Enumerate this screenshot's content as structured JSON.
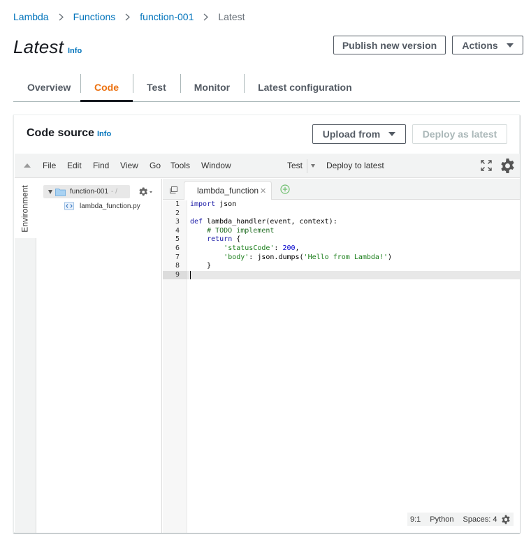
{
  "breadcrumb": {
    "items": [
      "Lambda",
      "Functions",
      "function-001"
    ],
    "current": "Latest"
  },
  "header": {
    "title": "Latest",
    "info": "Info",
    "publish_label": "Publish new version",
    "actions_label": "Actions"
  },
  "tabs": [
    "Overview",
    "Code",
    "Test",
    "Monitor",
    "Latest configuration"
  ],
  "active_tab": "Code",
  "code_source": {
    "title": "Code source",
    "info": "Info",
    "upload_label": "Upload from",
    "deploy_label": "Deploy as latest"
  },
  "ide": {
    "menu": [
      "File",
      "Edit",
      "Find",
      "View",
      "Go",
      "Tools",
      "Window"
    ],
    "run_label": "Test",
    "deploy_label": "Deploy to latest",
    "env_tab": "Environment",
    "tree": {
      "root": "function-001",
      "root_path": "- /",
      "file": "lambda_function.py"
    },
    "editor_tab": "lambda_function",
    "code_lines": [
      "import json",
      "",
      "def lambda_handler(event, context):",
      "    # TODO implement",
      "    return {",
      "        'statusCode': 200,",
      "        'body': json.dumps('Hello from Lambda!')",
      "    }",
      ""
    ],
    "line_numbers": [
      "1",
      "2",
      "3",
      "4",
      "5",
      "6",
      "7",
      "8",
      "9"
    ],
    "status": {
      "position": "9:1",
      "language": "Python",
      "indent": "Spaces: 4"
    }
  },
  "colors": {
    "link": "#0073bb",
    "active_tab": "#ec7211",
    "text": "#16191f"
  }
}
